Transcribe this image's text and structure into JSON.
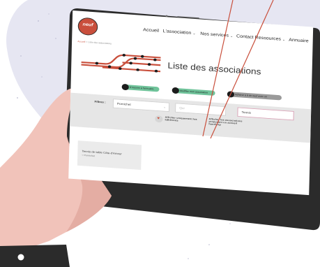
{
  "logo": {
    "text": "neuf"
  },
  "nav": {
    "items": [
      {
        "label": "Accueil"
      },
      {
        "label": "L'association",
        "dropdown": true
      },
      {
        "label": "Nos services",
        "dropdown": true
      },
      {
        "label": "Contact"
      },
      {
        "label": "Ressources",
        "dropdown": true
      },
      {
        "label": "Annuaire"
      }
    ]
  },
  "breadcrumb": {
    "home": "Accueil",
    "separator": " > ",
    "current": "Liste des associations"
  },
  "page": {
    "title": "Liste des associations"
  },
  "badges": [
    {
      "label": "S'inscrire à l'annuaire",
      "color": "#6fc39a"
    },
    {
      "label": "Modifier mon association",
      "color": "#6fc39a"
    },
    {
      "label": "Adhérer à 9 de neuf avec un",
      "color": "#9a9a9a"
    }
  ],
  "filters": {
    "label": "Filtres :",
    "city_select": {
      "value": "Pornichet"
    },
    "who_input": {
      "placeholder": "Qui"
    },
    "search_input": {
      "value": "Tennis"
    },
    "toggle_adherents_label": "Afficher uniquement les adhérents",
    "toggle_handicap_label": "Afficher les associations proposant un accueil handicap"
  },
  "results": [
    {
      "name": "Tennis de table Côte-d'Amour",
      "city": "Pornichet"
    }
  ],
  "colors": {
    "accent": "#c94f3c",
    "frame": "#2b2b2b",
    "blob": "#e6e6f2",
    "skin": "#f1c3ba"
  }
}
